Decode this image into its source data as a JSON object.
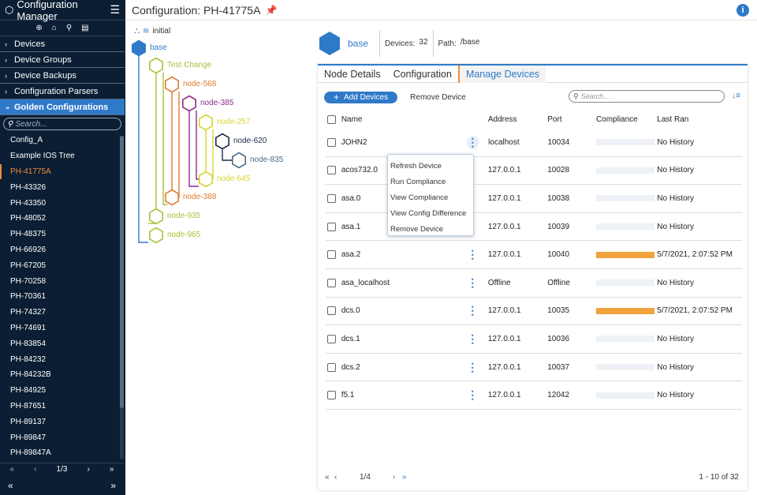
{
  "app": {
    "title": "Configuration Manager"
  },
  "sidebar": {
    "sections": [
      {
        "label": "Devices"
      },
      {
        "label": "Device Groups"
      },
      {
        "label": "Device Backups"
      },
      {
        "label": "Configuration Parsers"
      },
      {
        "label": "Golden Configurations"
      }
    ],
    "search_placeholder": "Search...",
    "items": [
      "Config_A",
      "Example IOS Tree",
      "PH-41775A",
      "PH-43326",
      "PH-43350",
      "PH-48052",
      "PH-48375",
      "PH-66926",
      "PH-67205",
      "PH-70258",
      "PH-70361",
      "PH-74327",
      "PH-74691",
      "PH-83854",
      "PH-84232",
      "PH-84232B",
      "PH-84925",
      "PH-87651",
      "PH-89137",
      "PH-89847",
      "PH-89847A"
    ],
    "selected": "PH-41775A",
    "page": "1/3"
  },
  "page": {
    "title": "Configuration: PH-41775A"
  },
  "tree": {
    "root_label": "initial",
    "nodes": [
      {
        "label": "base",
        "color": "#2f7ac8"
      },
      {
        "label": "Test Change",
        "color": "#a7c13b"
      },
      {
        "label": "node-568",
        "color": "#e07a2e"
      },
      {
        "label": "node-385",
        "color": "#8e2a8a"
      },
      {
        "label": "node-257",
        "color": "#d8d22e"
      },
      {
        "label": "node-620",
        "color": "#1e2a4a"
      },
      {
        "label": "node-835",
        "color": "#4a6b86"
      },
      {
        "label": "node-645",
        "color": "#d8d22e"
      },
      {
        "label": "node-388",
        "color": "#e07a2e"
      },
      {
        "label": "node-935",
        "color": "#a7c13b"
      },
      {
        "label": "node-965",
        "color": "#a7c13b"
      }
    ]
  },
  "node": {
    "name": "base",
    "devices_label": "Devices:",
    "devices_count": "32",
    "path_label": "Path:",
    "path": "/base"
  },
  "tabs": [
    "Node Details",
    "Configuration",
    "Manage Devices"
  ],
  "toolbar": {
    "add": "Add Devices",
    "remove": "Remove Device",
    "search_placeholder": "Search..."
  },
  "table": {
    "headers": {
      "name": "Name",
      "address": "Address",
      "port": "Port",
      "compliance": "Compliance",
      "last_ran": "Last Ran"
    },
    "rows": [
      {
        "name": "JOHN2",
        "address": "localhost",
        "port": "10034",
        "compliance": 0,
        "last_ran": "No History"
      },
      {
        "name": "acos732.0",
        "address": "127.0.0.1",
        "port": "10028",
        "compliance": 0,
        "last_ran": "No History"
      },
      {
        "name": "asa.0",
        "address": "127.0.0.1",
        "port": "10038",
        "compliance": 0,
        "last_ran": "No History"
      },
      {
        "name": "asa.1",
        "address": "127.0.0.1",
        "port": "10039",
        "compliance": 0,
        "last_ran": "No History"
      },
      {
        "name": "asa.2",
        "address": "127.0.0.1",
        "port": "10040",
        "compliance": 1,
        "last_ran": "5/7/2021, 2:07:52 PM"
      },
      {
        "name": "asa_localhost",
        "address": "Offline",
        "port": "Offline",
        "compliance": 0,
        "last_ran": "No History"
      },
      {
        "name": "dcs.0",
        "address": "127.0.0.1",
        "port": "10035",
        "compliance": 1,
        "last_ran": "5/7/2021, 2:07:52 PM"
      },
      {
        "name": "dcs.1",
        "address": "127.0.0.1",
        "port": "10036",
        "compliance": 0,
        "last_ran": "No History"
      },
      {
        "name": "dcs.2",
        "address": "127.0.0.1",
        "port": "10037",
        "compliance": 0,
        "last_ran": "No History"
      },
      {
        "name": "f5.1",
        "address": "127.0.0.1",
        "port": "12042",
        "compliance": 0,
        "last_ran": "No History"
      }
    ]
  },
  "context_menu": [
    "Refresh Device",
    "Run Compliance",
    "View Compliance",
    "View Config Difference",
    "Remove Device"
  ],
  "pager": {
    "page": "1/4",
    "range": "1 - 10 of 32"
  },
  "colors": {
    "accent": "#2f7ac8",
    "sidebar": "#0b1e33",
    "orange": "#f08b3b",
    "compliance_full": "#f0a33c"
  }
}
